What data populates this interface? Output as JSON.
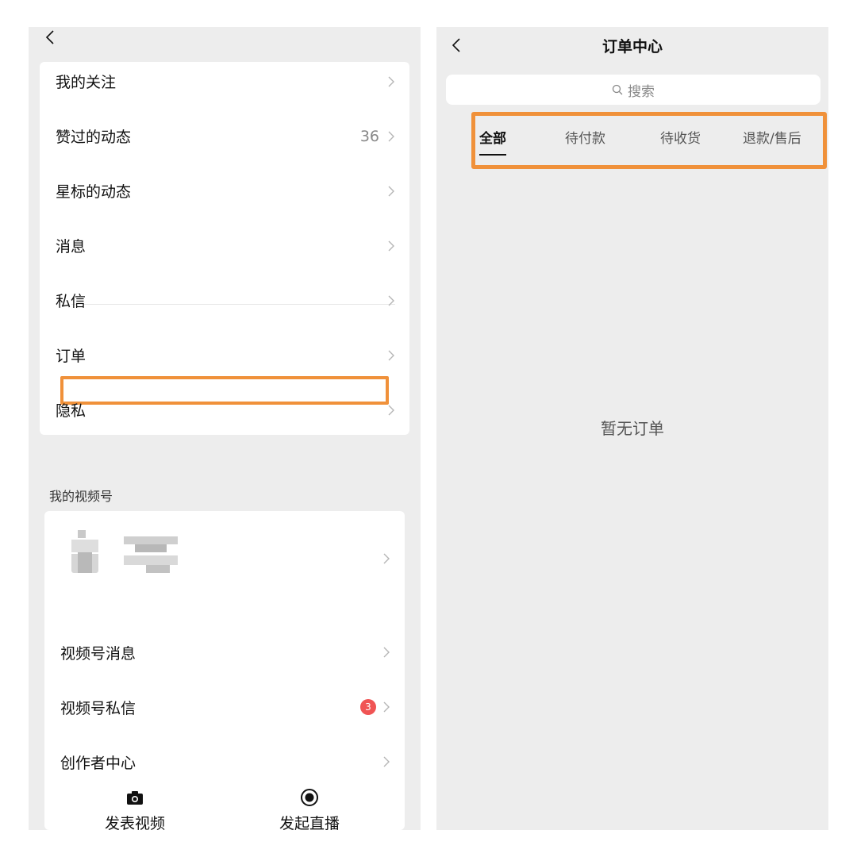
{
  "left": {
    "menu_items": [
      {
        "label": "我的关注"
      },
      {
        "label": "赞过的动态",
        "count": "36"
      },
      {
        "label": "星标的动态"
      },
      {
        "label": "消息"
      },
      {
        "label": "私信"
      },
      {
        "label": "订单"
      },
      {
        "label": "隐私"
      }
    ],
    "section_title": "我的视频号",
    "channel_items": [
      {
        "label": "视频号消息"
      },
      {
        "label": "视频号私信",
        "badge": "3"
      },
      {
        "label": "创作者中心"
      }
    ],
    "actions": [
      {
        "label": "发表视频",
        "icon": "camera-icon"
      },
      {
        "label": "发起直播",
        "icon": "record-icon"
      }
    ]
  },
  "right": {
    "title": "订单中心",
    "search_placeholder": "搜索",
    "tabs": [
      "全部",
      "待付款",
      "待收货",
      "退款/售后"
    ],
    "active_tab": "全部",
    "empty_message": "暂无订单"
  },
  "colors": {
    "highlight": "#f0913a",
    "badge": "#f05454",
    "panel_bg": "#ededed"
  }
}
